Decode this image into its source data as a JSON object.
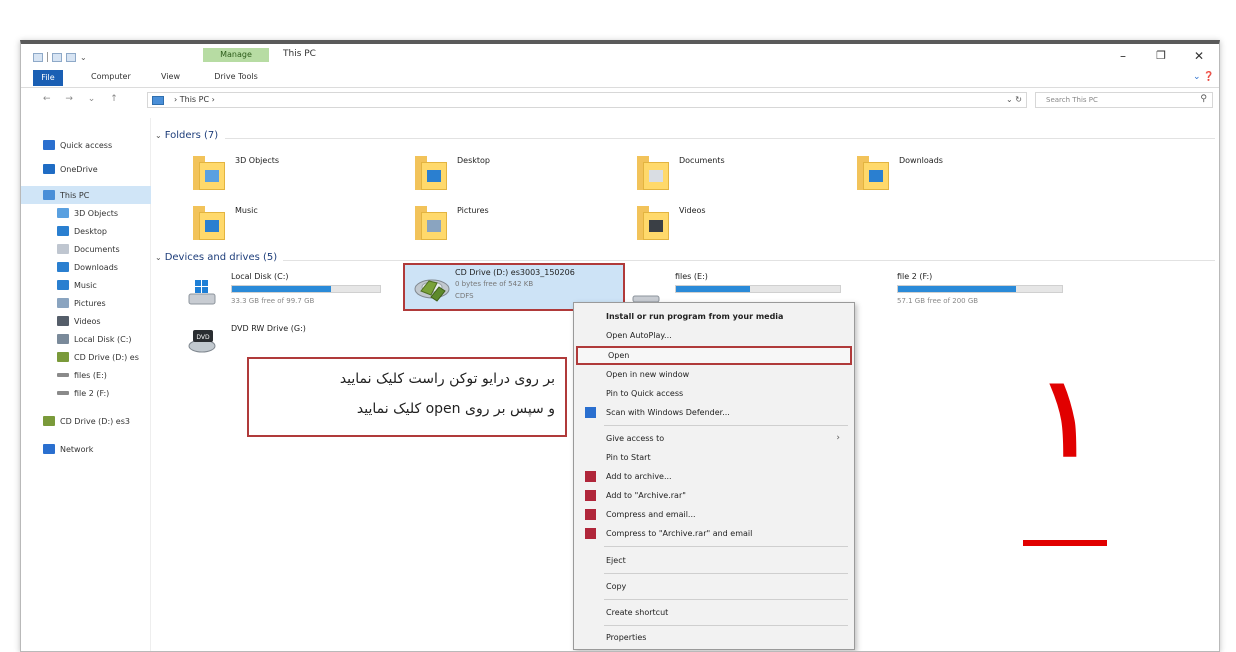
{
  "ribbon": {
    "manage_tab": "Manage",
    "window_title": "This PC",
    "tabs": {
      "file": "File",
      "computer": "Computer",
      "view": "View",
      "drive_tools": "Drive Tools"
    },
    "controls": {
      "minimize": "–",
      "maximize": "❐",
      "close": "✕",
      "help": "⌄ ❓"
    }
  },
  "address": {
    "nav": "← → ⌄ ↑",
    "path": "› This PC ›",
    "right_controls": "⌄ ↻",
    "search_placeholder": "Search This PC",
    "search_glyph": "⚲"
  },
  "nav_pane": {
    "items": [
      {
        "label": "Quick access",
        "color": "#2a6fcf"
      },
      {
        "label": "OneDrive",
        "color": "#1f6cc4"
      },
      {
        "label": "This PC",
        "color": "#4a8fd8"
      },
      {
        "label": "3D Objects",
        "color": "#5aa0e0"
      },
      {
        "label": "Desktop",
        "color": "#2a7fd0"
      },
      {
        "label": "Documents",
        "color": "#bfc6d0"
      },
      {
        "label": "Downloads",
        "color": "#2a7fd0"
      },
      {
        "label": "Music",
        "color": "#2a7fd0"
      },
      {
        "label": "Pictures",
        "color": "#8aa4c0"
      },
      {
        "label": "Videos",
        "color": "#555e6a"
      },
      {
        "label": "Local Disk (C:)",
        "color": "#7a8a9a"
      },
      {
        "label": "CD Drive (D:) es",
        "color": "#7a9a3a"
      },
      {
        "label": "files (E:)",
        "color": "#8a8a8a"
      },
      {
        "label": "file 2 (F:)",
        "color": "#8a8a8a"
      },
      {
        "label": "CD Drive (D:) es3",
        "color": "#7a9a3a"
      },
      {
        "label": "Network",
        "color": "#2a6fcf"
      }
    ]
  },
  "folders": {
    "header": "Folders (7)",
    "chevron": "⌄",
    "items": [
      {
        "label": "3D Objects",
        "emblem": "#5aa0e0"
      },
      {
        "label": "Desktop",
        "emblem": "#2a7fd0"
      },
      {
        "label": "Documents",
        "emblem": "#d9dde3"
      },
      {
        "label": "Downloads",
        "emblem": "#2a7fd0"
      },
      {
        "label": "Music",
        "emblem": "#2a7fd0"
      },
      {
        "label": "Pictures",
        "emblem": "#8aa4c0"
      },
      {
        "label": "Videos",
        "emblem": "#3a3f45"
      }
    ]
  },
  "drives": {
    "header": "Devices and drives (5)",
    "chevron": "⌄",
    "local_disk": {
      "name": "Local Disk (C:)",
      "free": "33.3 GB free of 99.7 GB",
      "used": 0.67
    },
    "cd_drive": {
      "name": "CD Drive (D:) es3003_150206",
      "bytes": "0 bytes free of 542 KB",
      "fs": "CDFS"
    },
    "files": {
      "name": "files (E:)",
      "used": 0.45
    },
    "file2": {
      "name": "file 2 (F:)",
      "free": "57.1 GB free of 200 GB",
      "used": 0.72
    },
    "dvd": {
      "name": "DVD RW Drive (G:)",
      "badge": "DVD"
    }
  },
  "context_menu": {
    "items": [
      "Install or run program from your media",
      "Open AutoPlay...",
      "Open",
      "Open in new window",
      "Pin to Quick access",
      "Scan with Windows Defender...",
      "Give access to",
      "Pin to Start",
      "Add to archive...",
      "Add to \"Archive.rar\"",
      "Compress and email...",
      "Compress to \"Archive.rar\" and email",
      "Eject",
      "Copy",
      "Create shortcut",
      "Properties"
    ],
    "submenu_arrow": "›"
  },
  "annotation": {
    "line1": "بر روی درایو توکن راست کلیک نمایید",
    "line2": "و سپس بر روی open کلیک نمایید",
    "step_number": "١"
  },
  "colors": {
    "accent": "#1a5fb4",
    "highlight_border": "#b03a3a",
    "step_red": "#e10000",
    "bar": "#2a8ad8"
  }
}
